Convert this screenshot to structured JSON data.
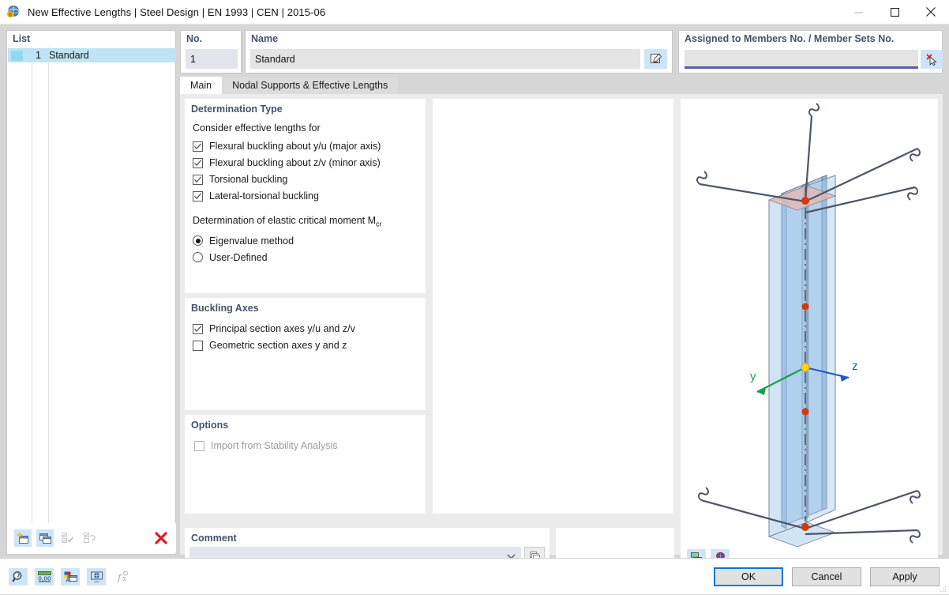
{
  "window": {
    "title": "New Effective Lengths | Steel Design | EN 1993 | CEN | 2015-06",
    "icon": "app-sphere-icon",
    "minimize": "—",
    "maximize": "☐",
    "close": "✕"
  },
  "list": {
    "header": "List",
    "rows": [
      {
        "number": "1",
        "name": "Standard",
        "swatch_color": "#8fdcf0"
      }
    ],
    "toolbar": [
      {
        "name": "new-item-button",
        "icon": "new-window-star-icon",
        "enabled": true
      },
      {
        "name": "copy-item-button",
        "icon": "copy-window-icon",
        "enabled": true
      },
      {
        "name": "select-all-button",
        "icon": "check-all-icon",
        "enabled": false
      },
      {
        "name": "invert-selection-button",
        "icon": "toggle-check-icon",
        "enabled": false
      },
      {
        "name": "delete-item-button",
        "icon": "red-x-icon",
        "enabled": true
      }
    ]
  },
  "number_field": {
    "label": "No.",
    "value": "1"
  },
  "name_field": {
    "label": "Name",
    "value": "Standard",
    "edit_icon": "pencil-edit-icon"
  },
  "assigned": {
    "label": "Assigned to Members No. / Member Sets No.",
    "value": "",
    "placeholder": "",
    "pick_icon": "select-member-cursor-icon"
  },
  "tabs": [
    {
      "label": "Main",
      "active": true
    },
    {
      "label": "Nodal Supports & Effective Lengths",
      "active": false
    }
  ],
  "determination": {
    "title": "Determination Type",
    "subtitle": "Consider effective lengths for",
    "checkboxes": [
      {
        "label": "Flexural buckling about y/u (major axis)",
        "checked": true,
        "enabled": true
      },
      {
        "label": "Flexural buckling about z/v (minor axis)",
        "checked": true,
        "enabled": true
      },
      {
        "label": "Torsional buckling",
        "checked": true,
        "enabled": true
      },
      {
        "label": "Lateral-torsional buckling",
        "checked": true,
        "enabled": true
      }
    ],
    "mcr_label_prefix": "Determination of elastic critical moment M",
    "mcr_label_sub": "cr",
    "radios": [
      {
        "label": "Eigenvalue method",
        "selected": true
      },
      {
        "label": "User-Defined",
        "selected": false
      }
    ]
  },
  "buckling_axes": {
    "title": "Buckling Axes",
    "checkboxes": [
      {
        "label": "Principal section axes y/u and z/v",
        "checked": true,
        "enabled": true
      },
      {
        "label": "Geometric section axes y and z",
        "checked": false,
        "enabled": true
      }
    ]
  },
  "options": {
    "title": "Options",
    "checkboxes": [
      {
        "label": "Import from Stability Analysis",
        "checked": false,
        "enabled": false
      }
    ]
  },
  "comment": {
    "title": "Comment",
    "value": "",
    "placeholder": "",
    "dropdown_icon": "chevron-down-icon",
    "button_icon": "copy-stack-icon"
  },
  "viewport": {
    "axis_y_label": "y",
    "axis_z_label": "z",
    "axis_y_color": "#1a9e4b",
    "axis_z_color": "#2257c7",
    "origin_color": "#ffd21e",
    "node_color": "#d4380d",
    "member_fill": "#a9cdec",
    "member_edge": "#6e7a92",
    "icons": [
      {
        "name": "render-mode-icon"
      },
      {
        "name": "info-balloon-icon"
      }
    ]
  },
  "bottom_toolbar": [
    {
      "name": "magnifier-button",
      "icon": "magnifier-icon",
      "enabled": true
    },
    {
      "name": "units-button",
      "icon": "ruler-number-icon",
      "enabled": true
    },
    {
      "name": "display-properties-button",
      "icon": "colors-window-icon",
      "enabled": true
    },
    {
      "name": "visibility-button",
      "icon": "render-globe-icon",
      "enabled": true
    },
    {
      "name": "formula-button",
      "icon": "function-icon",
      "enabled": false
    }
  ],
  "dialog_buttons": [
    {
      "label": "OK",
      "default": true
    },
    {
      "label": "Cancel",
      "default": false
    },
    {
      "label": "Apply",
      "default": false
    }
  ],
  "colors": {
    "accent_blue": "#0078d7",
    "group_title": "#44546a",
    "selection": "#bfe4f5",
    "field_bg": "#e4e4e4",
    "field_focus_bg": "#e4e4ee"
  }
}
